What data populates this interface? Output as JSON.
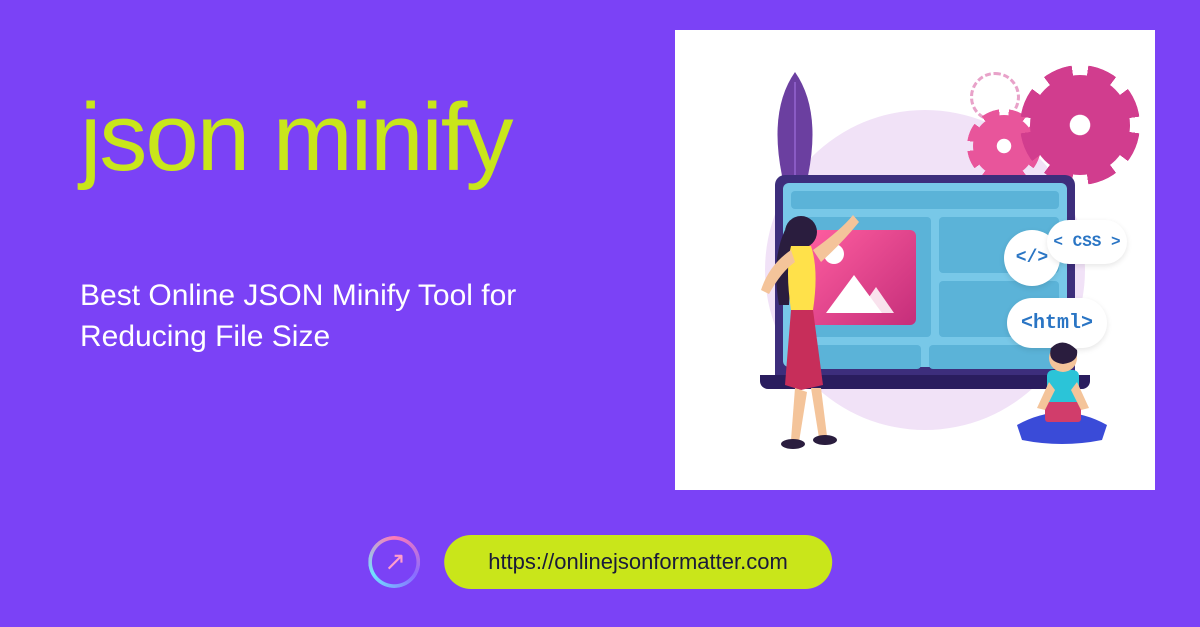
{
  "hero": {
    "title": "json minify",
    "subtitle": "Best Online JSON Minify Tool for Reducing File Size"
  },
  "badges": {
    "html": "<html>",
    "code": "</>",
    "css": "< CSS >"
  },
  "footer": {
    "url": "https://onlinejsonformatter.com"
  },
  "colors": {
    "background": "#7b42f6",
    "accent": "#c9e61a",
    "text": "#ffffff"
  }
}
